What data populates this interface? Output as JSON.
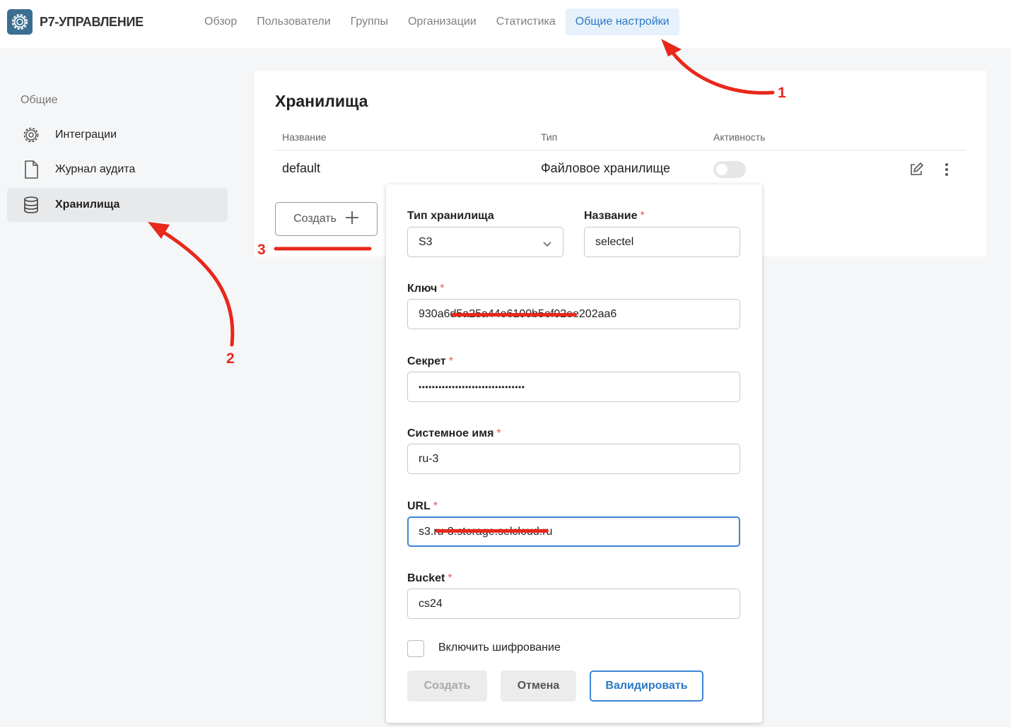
{
  "app": {
    "brand": "Р7-УПРАВЛЕНИЕ",
    "logo_icon": "gear-icon"
  },
  "nav": {
    "tabs": [
      {
        "label": "Обзор"
      },
      {
        "label": "Пользователи"
      },
      {
        "label": "Группы"
      },
      {
        "label": "Организации"
      },
      {
        "label": "Статистика"
      },
      {
        "label": "Общие настройки",
        "active": true
      }
    ]
  },
  "sidebar": {
    "section": "Общие",
    "items": [
      {
        "label": "Интеграции",
        "icon": "gear-icon"
      },
      {
        "label": "Журнал аудита",
        "icon": "document-icon"
      },
      {
        "label": "Хранилища",
        "icon": "database-icon",
        "active": true
      }
    ]
  },
  "storages": {
    "title": "Хранилища",
    "columns": {
      "name": "Название",
      "type": "Тип",
      "active": "Активность"
    },
    "rows": [
      {
        "name": "default",
        "type": "Файловое хранилище",
        "active": false
      }
    ],
    "create_button": "Создать"
  },
  "form": {
    "type_label": "Тип хранилища",
    "type_value": "S3",
    "name_label": "Название",
    "name_value": "selectel",
    "key_label": "Ключ",
    "key_value": "930a6d5a25a44e6100b5ef02ee202aa6",
    "secret_label": "Секрет",
    "secret_value": "••••••••••••••••••••••••••••••••",
    "system_name_label": "Системное имя",
    "system_name_value": "ru-3",
    "url_label": "URL",
    "url_value": "s3.ru-3.storage.selcloud.ru",
    "bucket_label": "Bucket",
    "bucket_value": "cs24",
    "required_mark": "*",
    "encryption_label": "Включить шифрование",
    "encryption_checked": false,
    "create_button": "Создать",
    "cancel_button": "Отмена",
    "validate_button": "Валидировать"
  },
  "annotations": {
    "marker_1": "1",
    "marker_2": "2",
    "marker_3": "3"
  },
  "colors": {
    "accent": "#2b78c5",
    "annotation": "#e8281b",
    "required": "#e25b5b"
  }
}
